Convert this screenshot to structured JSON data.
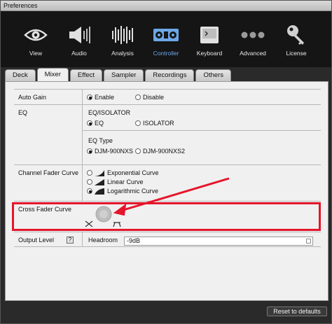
{
  "window": {
    "title": "Preferences"
  },
  "toolbar": {
    "items": [
      {
        "label": "View",
        "icon": "eye-icon",
        "active": false
      },
      {
        "label": "Audio",
        "icon": "speaker-icon",
        "active": false
      },
      {
        "label": "Analysis",
        "icon": "waveform-icon",
        "active": false
      },
      {
        "label": "Controller",
        "icon": "controller-icon",
        "active": true
      },
      {
        "label": "Keyboard",
        "icon": "keyboard-icon",
        "active": false
      },
      {
        "label": "Advanced",
        "icon": "dots-icon",
        "active": false
      },
      {
        "label": "License",
        "icon": "key-icon",
        "active": false
      }
    ],
    "active_color": "#6da7e8"
  },
  "tabs": [
    "Deck",
    "Mixer",
    "Effect",
    "Sampler",
    "Recordings",
    "Others"
  ],
  "active_tab": "Mixer",
  "mixer": {
    "auto_gain": {
      "label": "Auto Gain",
      "options": [
        "Enable",
        "Disable"
      ],
      "selected": "Enable"
    },
    "eq": {
      "label": "EQ",
      "group1_title": "EQ/ISOLATOR",
      "group1_options": [
        "EQ",
        "ISOLATOR"
      ],
      "group1_selected": "EQ",
      "group2_title": "EQ Type",
      "group2_options": [
        "DJM-900NXS",
        "DJM-900NXS2"
      ],
      "group2_selected": "DJM-900NXS"
    },
    "channel_fader_curve": {
      "label": "Channel Fader Curve",
      "options": [
        "Exponential Curve",
        "Linear Curve",
        "Logarithmic Curve"
      ],
      "selected": "Logarithmic Curve"
    },
    "cross_fader_curve": {
      "label": "Cross Fader Curve",
      "knob_level": 0.5
    },
    "output_level": {
      "label": "Output Level",
      "help": "?",
      "headroom_label": "Headroom",
      "headroom_value": "-9dB"
    }
  },
  "footer": {
    "reset_label": "Reset to defaults"
  },
  "annotation": {
    "color": "#e5152b"
  }
}
